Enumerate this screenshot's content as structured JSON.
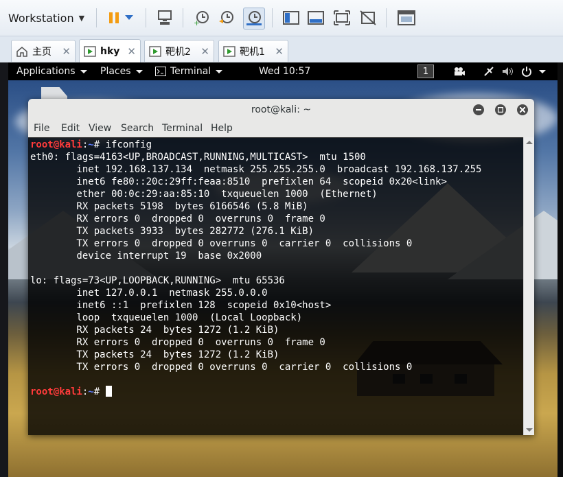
{
  "toolbar": {
    "menu_label": "Workstation",
    "buttons": [
      {
        "icon": "pause-icon"
      },
      {
        "icon": "dropdown-icon"
      },
      {
        "icon": "send-ctrl-alt-del-icon"
      },
      {
        "icon": "snapshot-take-icon"
      },
      {
        "icon": "snapshot-revert-icon"
      },
      {
        "icon": "snapshot-manager-icon"
      },
      {
        "icon": "show-library-icon"
      },
      {
        "icon": "console-view-icon"
      },
      {
        "icon": "full-screen-icon"
      },
      {
        "icon": "unity-icon"
      },
      {
        "icon": "thumbnail-view-icon"
      }
    ]
  },
  "tabs": [
    {
      "label": "主页",
      "icon": "home-icon",
      "active": false
    },
    {
      "label": "hky",
      "icon": "vm-running-icon",
      "active": true
    },
    {
      "label": "靶机2",
      "icon": "vm-running-icon",
      "active": false
    },
    {
      "label": "靶机1",
      "icon": "vm-running-icon",
      "active": false
    }
  ],
  "gnome_bar": {
    "applications": "Applications",
    "places": "Places",
    "terminal": "Terminal",
    "clock": "Wed 10:57",
    "workspace": "1"
  },
  "terminal": {
    "title": "root@kali: ~",
    "menu": [
      "File",
      "Edit",
      "View",
      "Search",
      "Terminal",
      "Help"
    ],
    "prompt_user": "root@kali",
    "prompt_sep": ":",
    "prompt_path": "~",
    "prompt_symbol": "# ",
    "command": "ifconfig",
    "output": [
      "eth0: flags=4163<UP,BROADCAST,RUNNING,MULTICAST>  mtu 1500",
      "        inet 192.168.137.134  netmask 255.255.255.0  broadcast 192.168.137.255",
      "        inet6 fe80::20c:29ff:feaa:8510  prefixlen 64  scopeid 0x20<link>",
      "        ether 00:0c:29:aa:85:10  txqueuelen 1000  (Ethernet)",
      "        RX packets 5198  bytes 6166546 (5.8 MiB)",
      "        RX errors 0  dropped 0  overruns 0  frame 0",
      "        TX packets 3933  bytes 282772 (276.1 KiB)",
      "        TX errors 0  dropped 0 overruns 0  carrier 0  collisions 0",
      "        device interrupt 19  base 0x2000",
      "",
      "lo: flags=73<UP,LOOPBACK,RUNNING>  mtu 65536",
      "        inet 127.0.0.1  netmask 255.0.0.0",
      "        inet6 ::1  prefixlen 128  scopeid 0x10<host>",
      "        loop  txqueuelen 1000  (Local Loopback)",
      "        RX packets 24  bytes 1272 (1.2 KiB)",
      "        RX errors 0  dropped 0  overruns 0  frame 0",
      "        TX packets 24  bytes 1272 (1.2 KiB)",
      "        TX errors 0  dropped 0 overruns 0  carrier 0  collisions 0",
      ""
    ]
  },
  "colors": {
    "prompt_user": "#ff3b3b",
    "prompt_path": "#5c7cff",
    "accent_orange": "#f39c12",
    "accent_blue": "#2f6fc6"
  }
}
